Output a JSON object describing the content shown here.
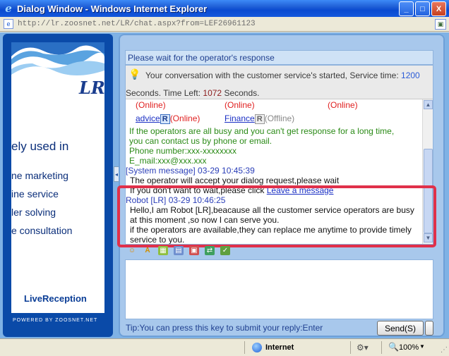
{
  "window": {
    "title": "Dialog Window - Windows Internet Explorer",
    "minimize": "_",
    "maximize": "□",
    "close": "X"
  },
  "address": {
    "url": "http://lr.zoosnet.net/LR/chat.aspx?from=LEF26961123"
  },
  "left": {
    "heading": "ely used in",
    "items": [
      "ne marketing",
      "ine service",
      "ler solving",
      "e consultation"
    ],
    "brand": "LiveReception",
    "powered": "POWERED BY ZOOSNET.NET"
  },
  "chat": {
    "header": "Please wait for the operator's response",
    "started": {
      "prefix": "Your conversation with the customer service's started, Service time:",
      "service_time": "1200",
      "seconds1": "Seconds. Time Left:",
      "time_left": "1072",
      "seconds2": "Seconds."
    },
    "online_top": [
      "(Online)",
      "(Online)",
      "(Online)"
    ],
    "departments": [
      {
        "name": "advice",
        "status": "(Online)"
      },
      {
        "name": "Finance",
        "status": "(Offline)"
      }
    ],
    "busy_lines": [
      "If the operators are all busy and you can't get response for a long time,",
      "you can contact us by phone or email.",
      "Phone number:xxx-xxxxxxxx",
      "E_mail:xxx@xxx.xxx"
    ],
    "system": {
      "label": "[System message] 03-29 10:45:39",
      "line1": "The operator will accept your dialog request,please wait",
      "line2_prefix": "If you don't want to wait,please click",
      "line2_link": "Leave a message"
    },
    "robot": {
      "label": "Robot [LR] 03-29 10:46:25",
      "lines": [
        "Hello,I am Robot [LR],beacause all the customer service operators are busy",
        "at this moment ,so now I can serve you.",
        "if the operators are available,they can replace me anytime to provide timely",
        "service to you."
      ]
    },
    "tip": "Tip:You can press this key to submit your reply:Enter",
    "send": "Send(S)"
  },
  "status": {
    "zone": "Internet",
    "zoom": "100%"
  },
  "colors": {
    "online": "#e02020",
    "highlight": "#e0304a",
    "titlebar": "#0a4ad0"
  }
}
